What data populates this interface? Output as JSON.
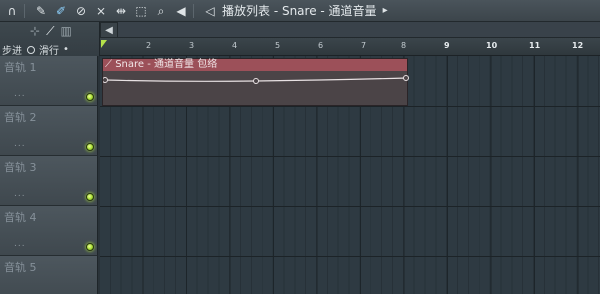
{
  "toolbar": {
    "title": "播放列表 - Snare - 通道音量",
    "icons": [
      "magnet-icon",
      "pencil-icon",
      "paint-icon",
      "mute-icon",
      "mute-tool-icon",
      "slip-icon",
      "select-icon",
      "zoom-icon",
      "playback-icon"
    ]
  },
  "left_panel": {
    "step_label": "步进",
    "slide_label": "滑行"
  },
  "ruler": {
    "ticks": [
      "2",
      "3",
      "4",
      "5",
      "6",
      "7",
      "8",
      "9",
      "10",
      "11",
      "12"
    ]
  },
  "tracks": [
    {
      "name": "音轨 1",
      "dots": "..."
    },
    {
      "name": "音轨 2",
      "dots": "..."
    },
    {
      "name": "音轨 3",
      "dots": "..."
    },
    {
      "name": "音轨 4",
      "dots": "..."
    },
    {
      "name": "音轨 5",
      "dots": "..."
    }
  ],
  "clip": {
    "title": "Snare - 通道音量 包络",
    "color": "#9c5059"
  }
}
